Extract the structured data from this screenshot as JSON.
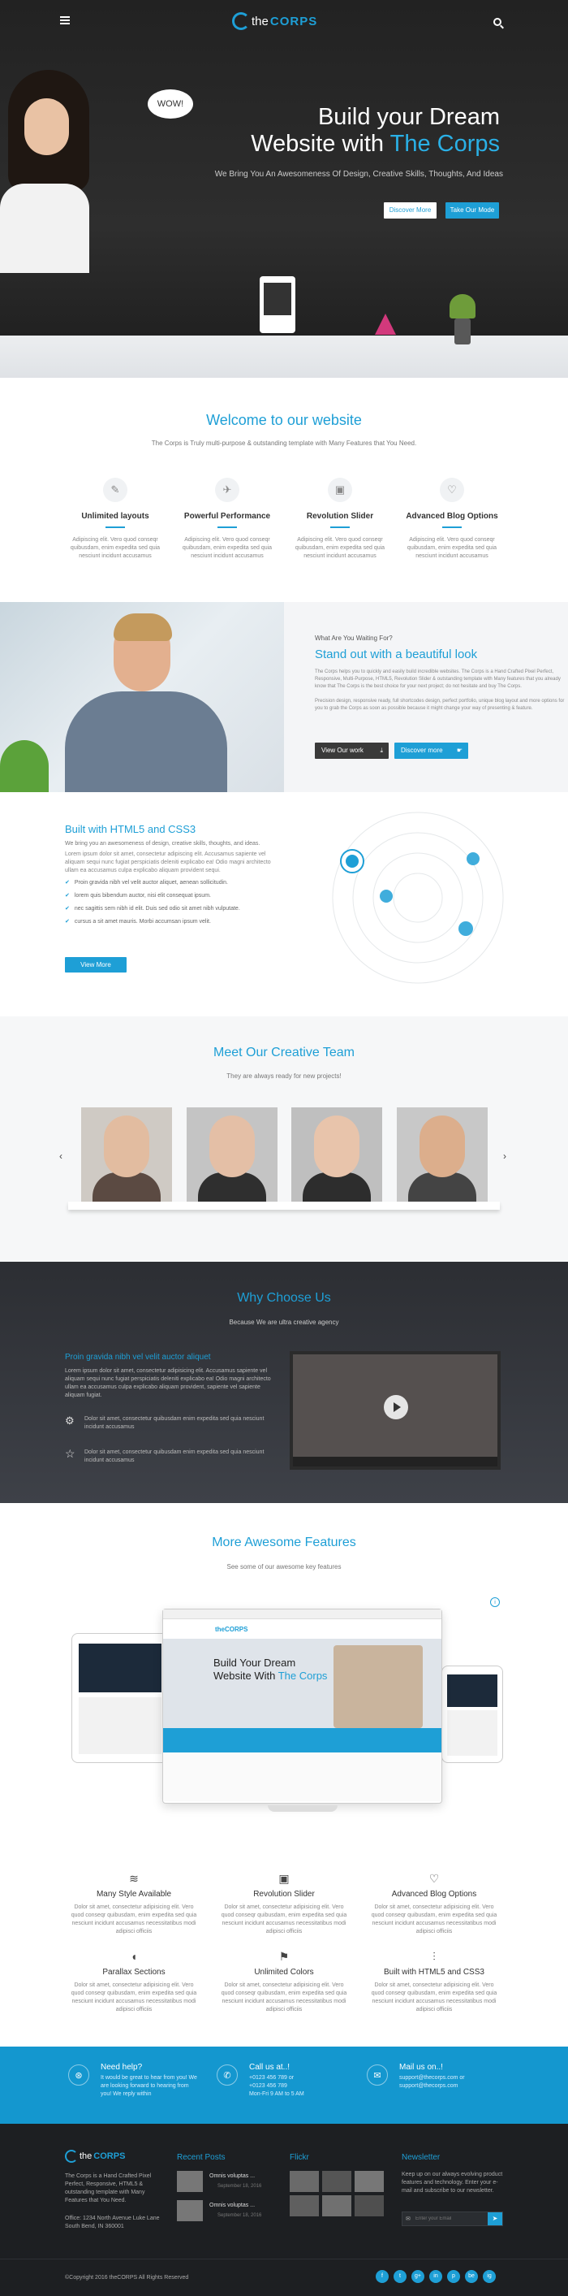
{
  "header": {
    "logo_prefix": "the",
    "logo_name": "CORPS"
  },
  "hero": {
    "title_line1": "Build your Dream",
    "title_line2_prefix": "Website with",
    "title_line2_brand": "The Corps",
    "subtitle": "We Bring You An Awesomeness Of Design, Creative Skills, Thoughts, And Ideas",
    "btn_discover": "Discover More",
    "btn_tour": "Take Our Mode",
    "bubble": "WOW!"
  },
  "welcome": {
    "title": "Welcome to our website",
    "subtitle": "The Corps is Truly multi-purpose & outstanding template with Many Features that You Need.",
    "features": [
      {
        "icon": "feather-icon",
        "title": "Unlimited layouts",
        "desc": "Adipiscing elit. Vero quod conseqr quibusdam, enim expedita sed quia nesciunt incidunt accusamus"
      },
      {
        "icon": "rocket-icon",
        "title": "Powerful Performance",
        "desc": "Adipiscing elit. Vero quod conseqr quibusdam, enim expedita sed quia nesciunt incidunt accusamus"
      },
      {
        "icon": "image-icon",
        "title": "Revolution Slider",
        "desc": "Adipiscing elit. Vero quod conseqr quibusdam, enim expedita sed quia nesciunt incidunt accusamus"
      },
      {
        "icon": "heart-icon",
        "title": "Advanced Blog Options",
        "desc": "Adipiscing elit. Vero quod conseqr quibusdam, enim expedita sed quia nesciunt incidunt accusamus"
      }
    ]
  },
  "standout": {
    "kicker": "What Are You Waiting For?",
    "title": "Stand out with a beautiful look",
    "p1": "The Corps helps you to quickly and easily build incredible websites. The Corps is a Hand Crafted Pixel Perfect, Responsive, Multi-Purpose, HTML5, Revolution Slider & outstanding template with Many features that you already know that The Corps is the best choice for your next project; do not hesitate and buy The Corps.",
    "p2": "Precision design, responsive ready, full shortcodes design, perfect portfolio, unique blog layout and more options for you to grab the Corps as soon as possible because it might change your way of presenting & feature.",
    "btn_view": "View Our work",
    "btn_discover": "Discover more"
  },
  "html5": {
    "title": "Built with HTML5 and CSS3",
    "intro": "We bring you an awesomeness of design, creative skills, thoughts, and ideas.",
    "para": "Lorem ipsum dolor sit amet, consectetur adipiscing elit. Accusamus sapiente vel aliquam sequi nunc fugiat perspiciatis deleniti explicabo ea! Odio magni architecto ullam ea accusamus culpa explicabo aliquam provident sequi.",
    "items": [
      "Proin gravida nibh vel velit auctor aliquet, aenean sollicitudin.",
      "lorem quis bibendum auctor, nisi elit consequat ipsum.",
      "nec sagittis sem nibh id elit. Duis sed odio sit amet nibh vulputate.",
      "cursus a sit amet mauris. Morbi accumsan ipsum velit."
    ],
    "button": "View More"
  },
  "team": {
    "title": "Meet Our Creative Team",
    "subtitle": "They are always ready for new projects!"
  },
  "why": {
    "title": "Why Choose Us",
    "subtitle": "Because We are ultra creative agency",
    "lead": "Proin gravida nibh vel velit auctor aliquet",
    "para": "Lorem ipsum dolor sit amet, consectetur adipisicing elit. Accusamus sapiente vel aliquam sequi nunc fugiat perspiciatis deleniti explicabo ea! Odio magni architecto ullam ea accusamus culpa explicabo aliquam provident, sapiente vel sapiente aliquam fugiat.",
    "point1": "Dolor sit amet, consectetur quibusdam enim expedita sed quia nesciunt incidunt accusamus",
    "point2": "Dolor sit amet, consectetur quibusdam enim expedita sed quia nesciunt incidunt accusamus"
  },
  "awesome": {
    "title": "More Awesome Features",
    "subtitle": "See some of our awesome key features",
    "monitor_logo": "theCORPS",
    "monitor_title1": "Build Your Dream",
    "monitor_title2": "Website With",
    "monitor_brand": "The Corps",
    "features": [
      {
        "icon": "layers-icon",
        "title": "Many Style Available",
        "desc": "Dolor sit amet, consectetur adipisicing elit. Vero quod conseqr quibusdam, enim expedita sed quia nesciunt incidunt accusamus necessitatibus modi adipisci officiis"
      },
      {
        "icon": "image-icon",
        "title": "Revolution Slider",
        "desc": "Dolor sit amet, consectetur adipisicing elit. Vero quod conseqr quibusdam, enim expedita sed quia nesciunt incidunt accusamus necessitatibus modi adipisci officiis"
      },
      {
        "icon": "heart-icon",
        "title": "Advanced Blog Options",
        "desc": "Dolor sit amet, consectetur adipisicing elit. Vero quod conseqr quibusdam, enim expedita sed quia nesciunt incidunt accusamus necessitatibus modi adipisci officiis"
      },
      {
        "icon": "mouse-icon",
        "title": "Parallax Sections",
        "desc": "Dolor sit amet, consectetur adipisicing elit. Vero quod conseqr quibusdam, enim expedita sed quia nesciunt incidunt accusamus necessitatibus modi adipisci officiis"
      },
      {
        "icon": "flag-icon",
        "title": "Unlimited Colors",
        "desc": "Dolor sit amet, consectetur adipisicing elit. Vero quod conseqr quibusdam, enim expedita sed quia nesciunt incidunt accusamus necessitatibus modi adipisci officiis"
      },
      {
        "icon": "sliders-icon",
        "title": "Built with HTML5 and CSS3",
        "desc": "Dolor sit amet, consectetur adipisicing elit. Vero quod conseqr quibusdam, enim expedita sed quia nesciunt incidunt accusamus necessitatibus modi adipisci officiis"
      }
    ]
  },
  "band": {
    "help_title": "Need help?",
    "help_text1": "It would be great to hear from you! We",
    "help_text2": "are looking forward to hearing from",
    "help_text3": "you! We reply within",
    "call_title": "Call us at..!",
    "call_line1": "+0123 456 789 or",
    "call_line2": "+0123 456 789",
    "call_line3": "Mon-Fri 9 AM to 5 AM",
    "mail_title": "Mail us on..!",
    "mail_line1": "support@thecorps.com or",
    "mail_line2": "support@thecorps.com"
  },
  "footer": {
    "logo_prefix": "the",
    "logo_name": "CORPS",
    "about": "The Corps is a Hand Crafted Pixel Perfect, Responsive, HTML5 & outstanding template with Many Features that You Need.",
    "address": "Office: 1234 North Avenue Luke Lane South Bend, IN 360001",
    "recent_title": "Recent Posts",
    "post1": "Omnis voluptas ...",
    "post1_date": "September 18, 2016",
    "post2": "Omnis voluptas ...",
    "post2_date": "September 18, 2016",
    "flickr_title": "Flickr",
    "news_title": "Newsletter",
    "news_text": "Keep up on our always evolving product features and technology. Enter your e-mail and subscribe to our newsletter.",
    "email_placeholder": "Enter your Email",
    "copyright": "©Copyright 2016 theCORPS All Rights Reserved",
    "socials": [
      "f",
      "t",
      "g+",
      "in",
      "p",
      "be",
      "ig"
    ]
  },
  "colors": {
    "accent": "#1e9fd6",
    "dark": "#1d1f22"
  }
}
